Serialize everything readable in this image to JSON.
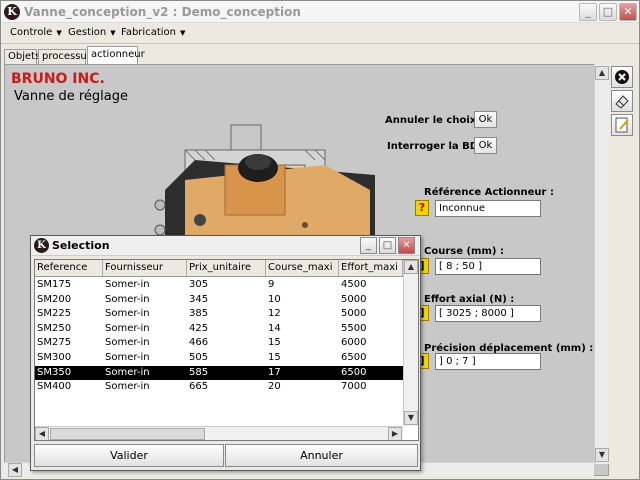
{
  "window": {
    "title": "Vanne_conception_v2 : Demo_conception",
    "app_icon_letter": "K",
    "minimize": "_",
    "maximize": "□",
    "close": "✕"
  },
  "menu": [
    {
      "label": "Controle",
      "arrow": "▼"
    },
    {
      "label": "Gestion",
      "arrow": "▼"
    },
    {
      "label": "Fabrication",
      "arrow": "▼"
    }
  ],
  "tabs": [
    {
      "label": "Objets"
    },
    {
      "label": "processus"
    },
    {
      "label": "actionneur",
      "active": true
    }
  ],
  "panel": {
    "company": "BRUNO INC.",
    "subtitle": "Vanne de réglage",
    "annuler_label": "Annuler le choix :",
    "interroger_label": "Interroger la BD :",
    "ok_label": "Ok",
    "ref_label": "Référence Actionneur :",
    "ref_value": "Inconnue",
    "ref_flag": "?",
    "course_label": "Course (mm) :",
    "course_value": "[ 8 ; 50 ]",
    "effort_label": "Effort axial (N) :",
    "effort_value": "[ 3025 ; 8000 ]",
    "precision_label": "Précision déplacement (mm) :",
    "precision_value": "] 0 ; 7 ]",
    "flag_bracket": "]"
  },
  "dialog": {
    "title": "Selection",
    "icon_letter": "K",
    "columns": [
      "Reference",
      "Fournisseur",
      "Prix_unitaire",
      "Course_maxi",
      "Effort_maxi"
    ],
    "rows": [
      [
        "SM175",
        "Somer-in",
        "305",
        "9",
        "4500"
      ],
      [
        "SM200",
        "Somer-in",
        "345",
        "10",
        "5000"
      ],
      [
        "SM225",
        "Somer-in",
        "385",
        "12",
        "5000"
      ],
      [
        "SM250",
        "Somer-in",
        "425",
        "14",
        "5500"
      ],
      [
        "SM275",
        "Somer-in",
        "466",
        "15",
        "6000"
      ],
      [
        "SM300",
        "Somer-in",
        "505",
        "15",
        "6500"
      ],
      [
        "SM350",
        "Somer-in",
        "585",
        "17",
        "6500"
      ],
      [
        "SM400",
        "Somer-in",
        "665",
        "20",
        "7000"
      ]
    ],
    "selected_row": "SM350",
    "valider": "Valider",
    "annuler": "Annuler"
  },
  "colors": {
    "company": "#cc1a1a",
    "panel_bg": "#c8c8c8",
    "flag": "#f1d400",
    "actuator": "#e0a968"
  }
}
